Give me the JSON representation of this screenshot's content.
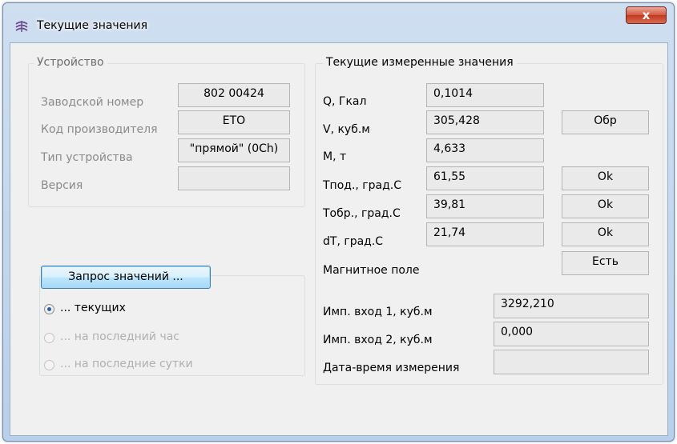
{
  "window": {
    "title": "Текущие значения",
    "close_label": "x"
  },
  "device_group": {
    "title": "Устройство",
    "rows": [
      {
        "label": "Заводской номер",
        "value": "802 00424"
      },
      {
        "label": "Код производителя",
        "value": "ETO"
      },
      {
        "label": "Тип устройства",
        "value": "\"прямой\" (0Ch)"
      },
      {
        "label": "Версия",
        "value": ""
      }
    ]
  },
  "request_group": {
    "button_label": "Запрос значений ...",
    "options": [
      {
        "label": "... текущих",
        "checked": true,
        "enabled": true
      },
      {
        "label": "... на последний час",
        "checked": false,
        "enabled": false
      },
      {
        "label": "... на последние сутки",
        "checked": false,
        "enabled": false
      }
    ]
  },
  "measured_group": {
    "title": "Текущие измеренные значения",
    "rows": [
      {
        "label": "Q, Гкал",
        "value": "0,1014",
        "status": ""
      },
      {
        "label": "V, куб.м",
        "value": "305,428",
        "status": "Обр"
      },
      {
        "label": "M, т",
        "value": "4,633",
        "status": ""
      },
      {
        "label": "Tпод., град.С",
        "value": "61,55",
        "status": "Ok"
      },
      {
        "label": "Tобр., град.С",
        "value": "39,81",
        "status": "Ok"
      },
      {
        "label": "dT, град.С",
        "value": "21,74",
        "status": "Ok"
      }
    ],
    "magnetic_label": "Магнитное поле",
    "magnetic_value": "Есть",
    "pulse_rows": [
      {
        "label": "Имп. вход 1, куб.м",
        "value": "3292,210"
      },
      {
        "label": "Имп. вход 2, куб.м",
        "value": "0,000"
      },
      {
        "label": "Дата-время измерения",
        "value": ""
      }
    ]
  },
  "colors": {
    "accent": "#2a5fa0",
    "close": "#c0391f"
  }
}
